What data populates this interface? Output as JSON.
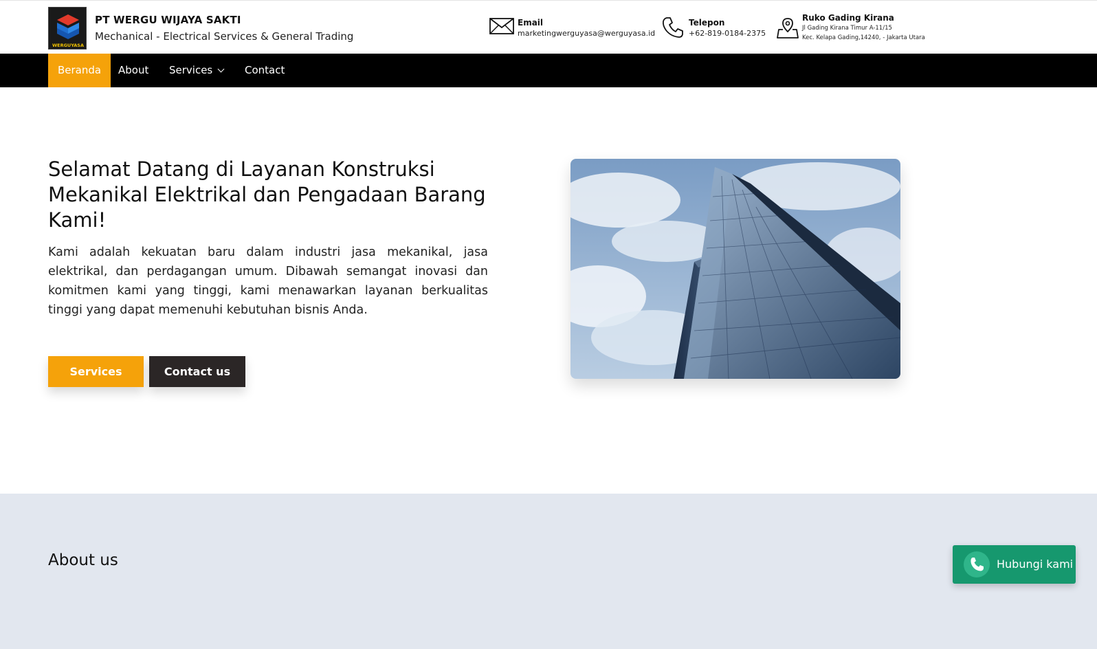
{
  "brand": {
    "name": "PT WERGU WIJAYA SAKTI",
    "tagline": "Mechanical - Electrical Services & General Trading",
    "logo_text": "WERGUYASA"
  },
  "contacts": {
    "email": {
      "title": "Email",
      "value": "marketingwerguyasa@werguyasa.id",
      "icon": "envelope-icon"
    },
    "phone": {
      "title": "Telepon",
      "value": "+62-819-0184-2375",
      "icon": "phone-icon"
    },
    "address": {
      "title": "Ruko Gading Kirana",
      "line1": "Jl Gading Kirana Timur A-11/15",
      "line2": "Kec. Kelapa Gading,14240, - Jakarta Utara",
      "icon": "map-pin-icon"
    }
  },
  "nav": {
    "items": [
      {
        "label": "Beranda",
        "active": true
      },
      {
        "label": "About"
      },
      {
        "label": "Services",
        "dropdown": true
      },
      {
        "label": "Contact"
      }
    ]
  },
  "hero": {
    "title": "Selamat Datang di Layanan Konstruksi Mekanikal Elektrikal dan Pengadaan Barang Kami!",
    "text": "Kami adalah kekuatan baru dalam industri jasa mekanikal, jasa elektrikal, dan perdagangan umum. Dibawah semangat inovasi dan komitmen kami yang tinggi, kami menawarkan layanan berkualitas tinggi yang dapat memenuhi kebutuhan bisnis Anda.",
    "btn_services": "Services",
    "btn_contact": "Contact us"
  },
  "about": {
    "title": "About us"
  },
  "whatsapp": {
    "label": "Hubungi kami",
    "icon": "phone-icon"
  },
  "colors": {
    "accent": "#f5a20a",
    "nav_bg": "#000000",
    "dark_button": "#2b2626",
    "whatsapp": "#16986e",
    "about_bg": "#e2e7ef"
  }
}
